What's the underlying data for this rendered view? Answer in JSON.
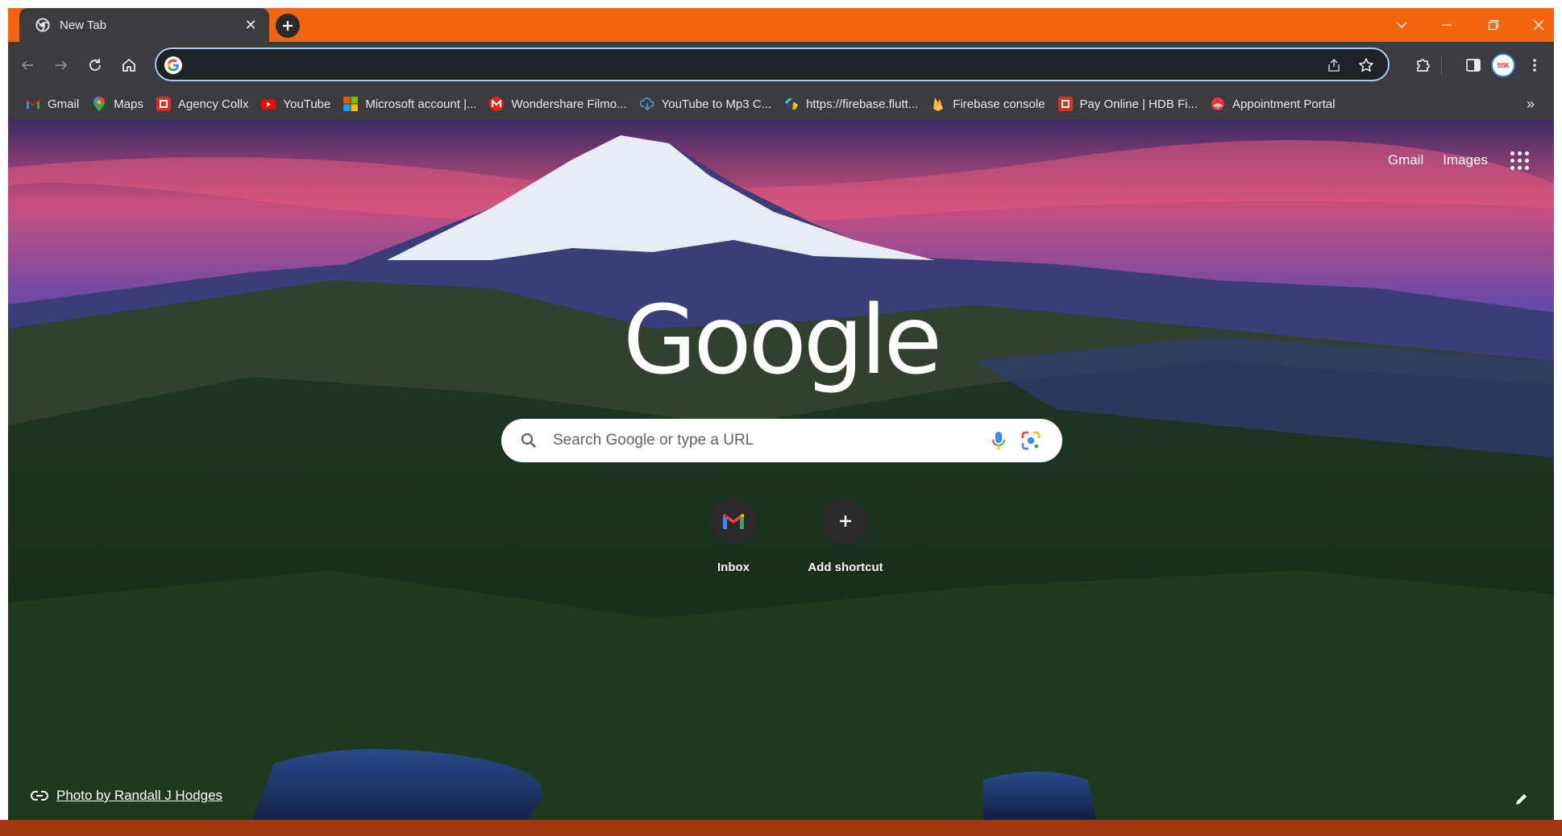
{
  "window": {
    "accent_color": "#f3650f",
    "tab": {
      "title": "New Tab",
      "favicon": "chrome-icon",
      "close_icon": "close-icon"
    },
    "new_tab_icon": "plus-icon",
    "controls": [
      "chevron-down-icon",
      "minimize-icon",
      "restore-icon",
      "close-icon"
    ]
  },
  "toolbar": {
    "back_icon": "arrow-left-icon",
    "forward_icon": "arrow-right-icon",
    "reload_icon": "reload-icon",
    "home_icon": "home-icon",
    "omnibox": {
      "value": "",
      "placeholder": ""
    },
    "share_icon": "share-icon",
    "star_icon": "star-icon",
    "extensions_icon": "puzzle-icon",
    "side_panel_icon": "side-panel-icon",
    "profile_text": "SSK",
    "menu_icon": "kebab-menu-icon"
  },
  "bookmarks": {
    "items": [
      {
        "label": "Gmail",
        "icon": "gmail-icon",
        "color": "#ea4335"
      },
      {
        "label": "Maps",
        "icon": "maps-pin-icon",
        "color": "#34a853"
      },
      {
        "label": "Agency Collx",
        "icon": "hdb-icon",
        "color": "#d93025"
      },
      {
        "label": "YouTube",
        "icon": "youtube-icon",
        "color": "#ff0000"
      },
      {
        "label": "Microsoft account |...",
        "icon": "microsoft-icon",
        "color": "#f25022"
      },
      {
        "label": "Wondershare Filmo...",
        "icon": "wondershare-icon",
        "color": "#e2231a"
      },
      {
        "label": "YouTube to Mp3 C...",
        "icon": "cloud-download-icon",
        "color": "#4aa3df"
      },
      {
        "label": "https://firebase.flutt...",
        "icon": "flutter-firebase-icon",
        "color": "#ffca28"
      },
      {
        "label": "Firebase console",
        "icon": "firebase-icon",
        "color": "#ffa000"
      },
      {
        "label": "Pay Online | HDB Fi...",
        "icon": "hdb-icon",
        "color": "#d93025"
      },
      {
        "label": "Appointment Portal",
        "icon": "signal-icon",
        "color": "#e53935"
      }
    ],
    "more_icon": "chevron-double-right-icon"
  },
  "ntp": {
    "links": {
      "gmail": "Gmail",
      "images": "Images"
    },
    "apps_icon": "apps-grid-icon",
    "logo": "Google",
    "search": {
      "placeholder": "Search Google or type a URL",
      "value": ""
    },
    "shortcuts": [
      {
        "label": "Inbox",
        "icon": "gmail-icon"
      },
      {
        "label": "Add shortcut",
        "icon": "plus-icon"
      }
    ],
    "photo_credit": "Photo by Randall J Hodges",
    "link_icon": "link-icon",
    "customize_icon": "pencil-icon"
  }
}
